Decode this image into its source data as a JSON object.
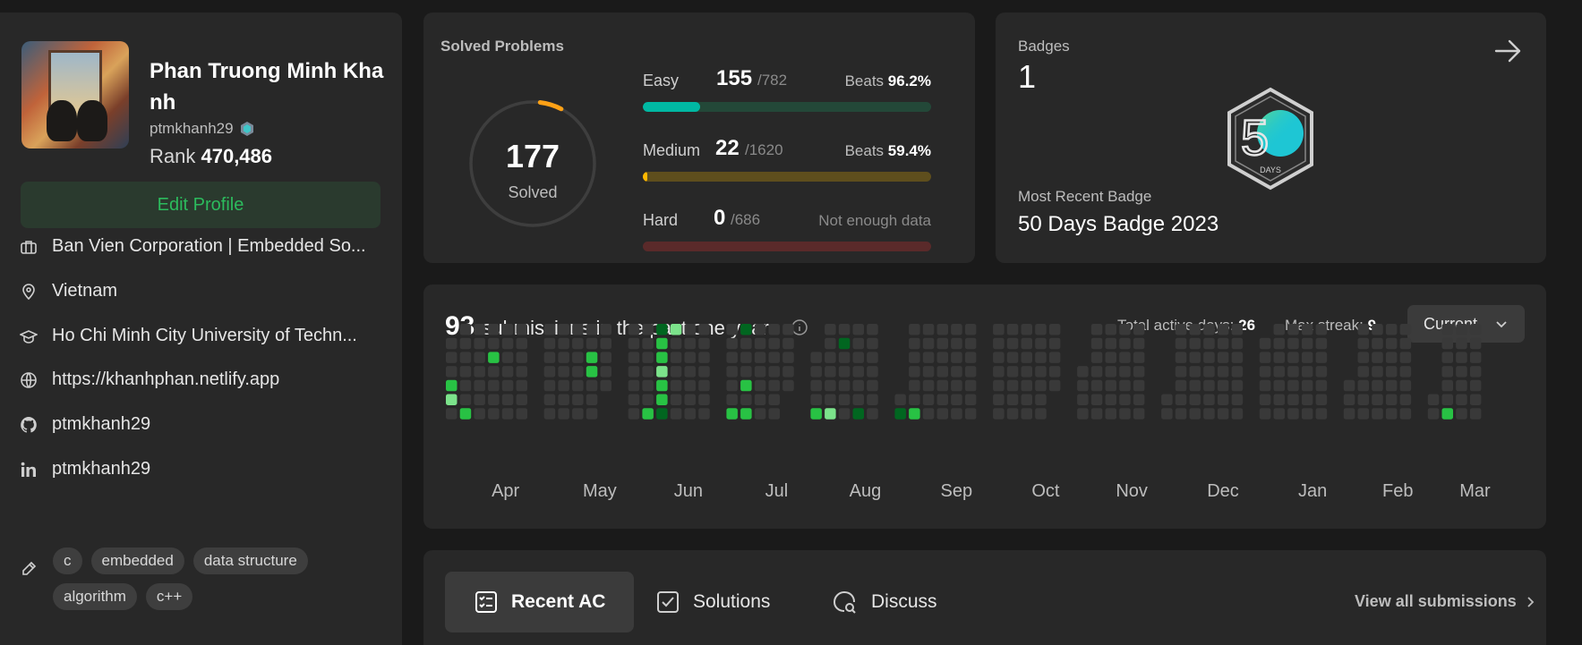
{
  "profile": {
    "name": "Phan Truong Minh Khanh",
    "name_line1": "Phan Truong Minh Kha",
    "name_line2": "nh",
    "handle": "ptmkhanh29",
    "rank_label": "Rank",
    "rank_value": "470,486",
    "edit_label": "Edit Profile",
    "company": "Ban Vien Corporation | Embedded So...",
    "location": "Vietnam",
    "school": "Ho Chi Minh City University of Techn...",
    "website": "https://khanhphan.netlify.app",
    "github": "ptmkhanh29",
    "linkedin": "ptmkhanh29",
    "skills": [
      "c",
      "embedded",
      "data structure",
      "algorithm",
      "c++"
    ]
  },
  "solved": {
    "title": "Solved Problems",
    "total": "177",
    "label": "Solved",
    "total_problems": 3088,
    "difficulties": [
      {
        "name": "Easy",
        "count": "155",
        "total": "/782",
        "beats_label": "Beats",
        "beats": "96.2%",
        "fraction": 0.198,
        "color": "#00b8a3",
        "track": "#2a4a3a"
      },
      {
        "name": "Medium",
        "count": "22",
        "total": "/1620",
        "beats_label": "Beats",
        "beats": "59.4%",
        "fraction": 0.014,
        "color": "#ffb800",
        "track": "#5e4e1d"
      },
      {
        "name": "Hard",
        "count": "0",
        "total": "/686",
        "beats_label": "",
        "beats": "Not enough data",
        "fraction": 0.0,
        "color": "#ef4743",
        "track": "#5a2a2a"
      }
    ]
  },
  "badges": {
    "title": "Badges",
    "count": "1",
    "recent_title": "Most Recent Badge",
    "recent_name": "50 Days Badge 2023",
    "badge_text": "DAYS"
  },
  "submissions": {
    "count": "93",
    "text": "submissions in the past one year",
    "active_days_label": "Total active days:",
    "active_days": "26",
    "max_streak_label": "Max streak:",
    "max_streak": "9",
    "dropdown": "Current",
    "months": [
      "Apr",
      "May",
      "Jun",
      "Jul",
      "Aug",
      "Sep",
      "Oct",
      "Nov",
      "Dec",
      "Jan",
      "Feb",
      "Mar"
    ],
    "level_colors": [
      "#393939",
      "#016620",
      "#28c244",
      "#7ce38b"
    ],
    "active_cells": [
      {
        "month": "Apr",
        "col": 0,
        "row": 4,
        "level": 2
      },
      {
        "month": "Apr",
        "col": 0,
        "row": 5,
        "level": 3
      },
      {
        "month": "Apr",
        "col": 1,
        "row": 6,
        "level": 2
      },
      {
        "month": "Apr",
        "col": 3,
        "row": 2,
        "level": 2
      },
      {
        "month": "May",
        "col": 3,
        "row": 2,
        "level": 2
      },
      {
        "month": "May",
        "col": 3,
        "row": 3,
        "level": 2
      },
      {
        "month": "Jun",
        "col": 1,
        "row": 6,
        "level": 2
      },
      {
        "month": "Jun",
        "col": 2,
        "row": 0,
        "level": 1
      },
      {
        "month": "Jun",
        "col": 2,
        "row": 1,
        "level": 2
      },
      {
        "month": "Jun",
        "col": 2,
        "row": 2,
        "level": 2
      },
      {
        "month": "Jun",
        "col": 2,
        "row": 3,
        "level": 3
      },
      {
        "month": "Jun",
        "col": 2,
        "row": 4,
        "level": 2
      },
      {
        "month": "Jun",
        "col": 2,
        "row": 5,
        "level": 2
      },
      {
        "month": "Jun",
        "col": 2,
        "row": 6,
        "level": 1
      },
      {
        "month": "Jun",
        "col": 3,
        "row": 0,
        "level": 3
      },
      {
        "month": "Jul",
        "col": 0,
        "row": 6,
        "level": 2
      },
      {
        "month": "Jul",
        "col": 1,
        "row": 0,
        "level": 1
      },
      {
        "month": "Jul",
        "col": 1,
        "row": 4,
        "level": 2
      },
      {
        "month": "Jul",
        "col": 1,
        "row": 6,
        "level": 2
      },
      {
        "month": "Aug",
        "col": 0,
        "row": 6,
        "level": 2
      },
      {
        "month": "Aug",
        "col": 1,
        "row": 6,
        "level": 3
      },
      {
        "month": "Aug",
        "col": 2,
        "row": 1,
        "level": 1
      },
      {
        "month": "Aug",
        "col": 3,
        "row": 6,
        "level": 1
      },
      {
        "month": "Sep",
        "col": 0,
        "row": 6,
        "level": 1
      },
      {
        "month": "Sep",
        "col": 1,
        "row": 6,
        "level": 2
      },
      {
        "month": "Mar",
        "col": 1,
        "row": 6,
        "level": 2
      }
    ]
  },
  "tabs": [
    {
      "label": "Recent AC",
      "icon": "list-check-icon"
    },
    {
      "label": "Solutions",
      "icon": "checkbox-icon"
    },
    {
      "label": "Discuss",
      "icon": "chat-search-icon"
    }
  ],
  "view_all": "View all submissions"
}
